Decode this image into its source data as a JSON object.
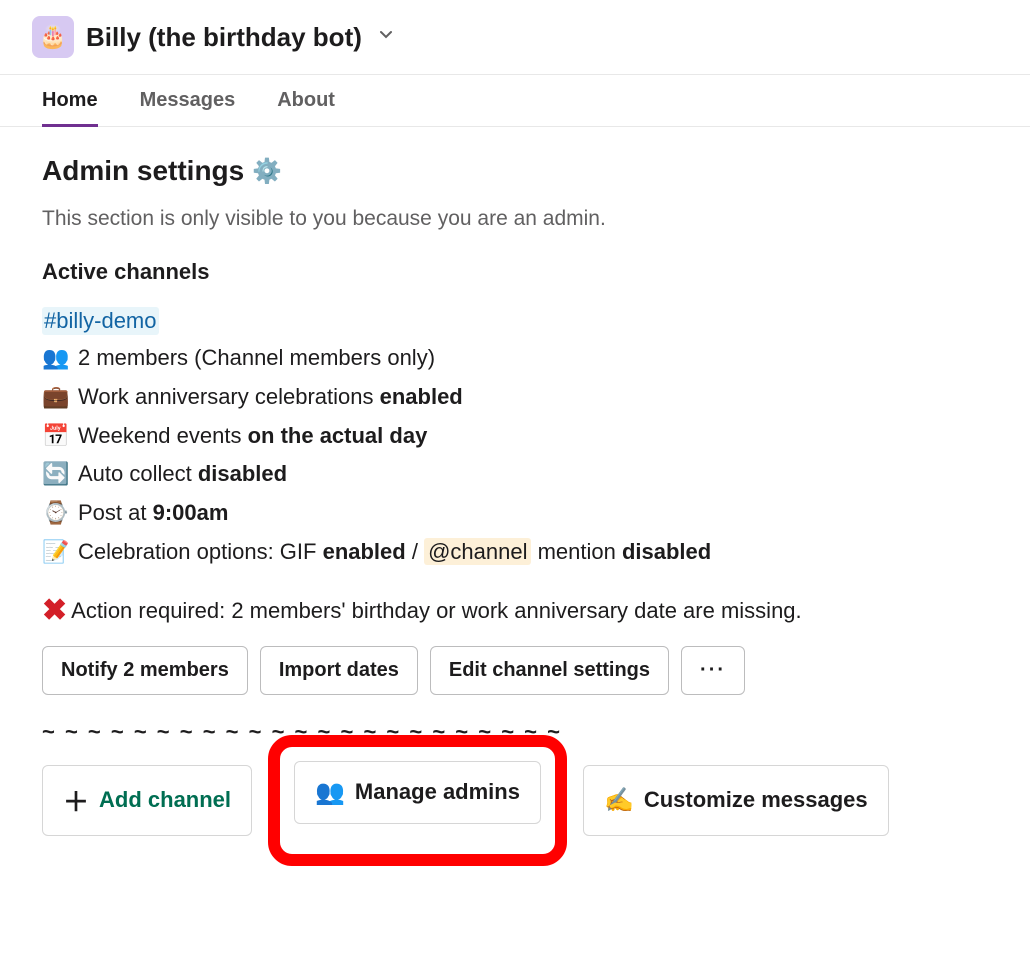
{
  "header": {
    "app_name": "Billy (the birthday bot)"
  },
  "tabs": {
    "home": "Home",
    "messages": "Messages",
    "about": "About"
  },
  "admin": {
    "title": "Admin settings",
    "subtitle": "This section is only visible to you because you are an admin.",
    "active_channels_label": "Active channels",
    "channel_link": "#billy-demo",
    "members_line": "2 members (Channel members only)",
    "anniversary_prefix": "Work anniversary celebrations ",
    "anniversary_state": "enabled",
    "weekend_prefix": "Weekend events ",
    "weekend_state": "on the actual day",
    "autocollect_prefix": "Auto collect ",
    "autocollect_state": "disabled",
    "post_prefix": "Post at ",
    "post_time": "9:00am",
    "celebration_prefix": "Celebration options: GIF ",
    "gif_state": "enabled",
    "separator": " / ",
    "at_channel": "@channel",
    "mention_word": " mention ",
    "mention_state": "disabled",
    "action_required": "Action required: 2 members' birthday or work anniversary date are missing."
  },
  "buttons": {
    "notify": "Notify 2 members",
    "import": "Import dates",
    "edit": "Edit channel settings",
    "more": "···",
    "add_channel": "Add channel",
    "manage_admins": "Manage admins",
    "customize_messages": "Customize messages"
  },
  "divider": "~ ~ ~ ~ ~ ~ ~ ~ ~ ~ ~ ~ ~ ~ ~ ~ ~ ~ ~ ~ ~ ~ ~"
}
